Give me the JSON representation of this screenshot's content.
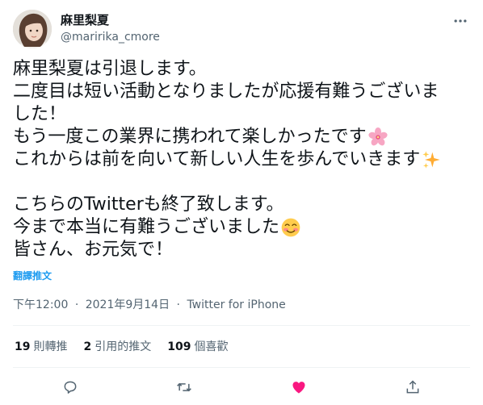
{
  "user": {
    "display_name": "麻里梨夏",
    "handle": "@maririka_cmore",
    "avatar_icon": "profile-photo"
  },
  "tweet": {
    "lines": [
      "麻里梨夏は引退します。",
      "二度目は短い活動となりましたが応援有難うございま",
      "した！",
      "もう一度この業界に携われて楽しかったです",
      "これからは前を向いて新しい人生を歩んでいきます",
      "",
      "こちらのTwitterも終了致します。",
      "今まで本当に有難うございました",
      "皆さん、お元気で！"
    ],
    "emojis": {
      "line4": "cherry-blossom-icon",
      "line5": "sparkles-icon",
      "line8": "smiling-face-icon"
    }
  },
  "translate_label": "翻譯推文",
  "meta": {
    "time": "下午12:00",
    "separator": "·",
    "date": "2021年9月14日",
    "source": "Twitter for iPhone"
  },
  "stats": {
    "retweets_count": "19",
    "retweets_label": "則轉推",
    "quotes_count": "2",
    "quotes_label": "引用的推文",
    "likes_count": "109",
    "likes_label": "個喜歡"
  },
  "colors": {
    "accent": "#1d9bf0",
    "like": "#f91880",
    "muted": "#536471",
    "text": "#0f1419"
  },
  "actions": [
    "reply-icon",
    "retweet-icon",
    "like-icon",
    "share-icon"
  ]
}
